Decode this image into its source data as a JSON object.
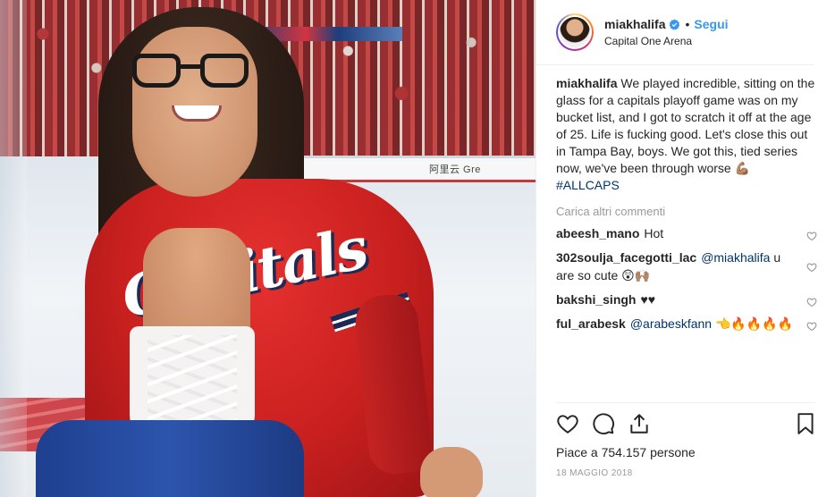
{
  "post": {
    "author": {
      "username": "miakhalifa",
      "follow_label": "Segui",
      "separator": "•",
      "location": "Capital One Arena"
    },
    "photo": {
      "boards_text": "阿里云  Gre"
    },
    "caption": {
      "username": "miakhalifa",
      "text": "We played incredible, sitting on the glass for a capitals playoff game was on my bucket list, and I got to scratch it off at the age of 25. Life is fucking good. Let's close this out in Tampa Bay, boys. We got this, tied series now, we've been through worse 💪🏽",
      "hashtag": "#ALLCAPS"
    },
    "load_more_label": "Carica altri commenti",
    "comments": [
      {
        "username": "abeesh_mano",
        "mention": "",
        "text": "Hot"
      },
      {
        "username": "302soulja_facegotti_lac",
        "mention": "@miakhalifa",
        "text": "u are so cute 😲🙌🏽"
      },
      {
        "username": "bakshi_singh",
        "mention": "",
        "text": "♥♥"
      },
      {
        "username": "ful_arabesk",
        "mention": "@arabeskfann",
        "text": "👈🔥🔥🔥🔥"
      }
    ],
    "likes_label": "Piace a 754.157 persone",
    "date_label": "18 MAGGIO 2018"
  },
  "colors": {
    "link": "#3897f0",
    "hashtag": "#003569",
    "muted": "#999999",
    "text": "#262626"
  },
  "icons": {
    "verified": "verified-badge-icon",
    "like": "heart-outline-icon",
    "comment": "speech-bubble-icon",
    "share": "share-arrow-icon",
    "save": "bookmark-icon"
  }
}
